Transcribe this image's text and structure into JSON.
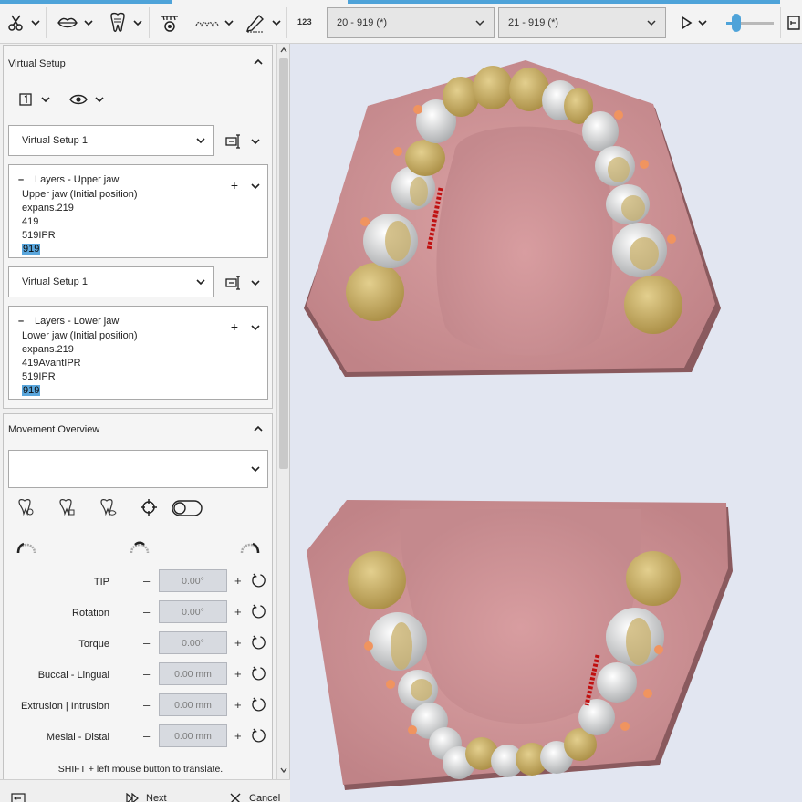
{
  "toolbar": {
    "tools": [
      {
        "icon": "scissors-icon"
      },
      {
        "icon": "lips-icon"
      },
      {
        "icon": "tooth-setup-icon"
      },
      {
        "icon": "teeth-gear-icon"
      },
      {
        "icon": "teeth-row-icon"
      },
      {
        "icon": "pencil-icon"
      }
    ],
    "numbering_label": "123",
    "stage_from": "20 - 919 (*)",
    "stage_to": "21 - 919 (*)",
    "slider_value": 0.22
  },
  "virtual_setup": {
    "title": "Virtual Setup",
    "upper": {
      "setup_select": "Virtual Setup 1",
      "layers_title": "Layers - Upper jaw",
      "layers": [
        "Upper jaw (Initial position)",
        "expans.219",
        "419",
        "519IPR",
        "919"
      ],
      "selected_layer": "919"
    },
    "lower": {
      "setup_select": "Virtual Setup 1",
      "layers_title": "Layers - Lower jaw",
      "layers": [
        "Lower jaw (Initial position)",
        "expans.219",
        "419AvantIPR",
        "519IPR",
        "919"
      ],
      "selected_layer": "919"
    }
  },
  "movement_overview": {
    "title": "Movement Overview",
    "select_value": "",
    "rows": [
      {
        "label": "TIP",
        "value": "0.00°"
      },
      {
        "label": "Rotation",
        "value": "0.00°"
      },
      {
        "label": "Torque",
        "value": "0.00°"
      },
      {
        "label": "Buccal - Lingual",
        "value": "0.00 mm"
      },
      {
        "label": "Extrusion | Intrusion",
        "value": "0.00 mm"
      },
      {
        "label": "Mesial - Distal",
        "value": "0.00 mm"
      }
    ],
    "hint": "SHIFT + left mouse button to translate."
  },
  "footer": {
    "next_label": "Next",
    "cancel_label": "Cancel"
  },
  "colors": {
    "accent": "#4ea3d9",
    "selection": "#5aa6dc",
    "gum": "#c98e92",
    "tooth_gold": "#c9b06a",
    "background": "#e2e6f1"
  }
}
